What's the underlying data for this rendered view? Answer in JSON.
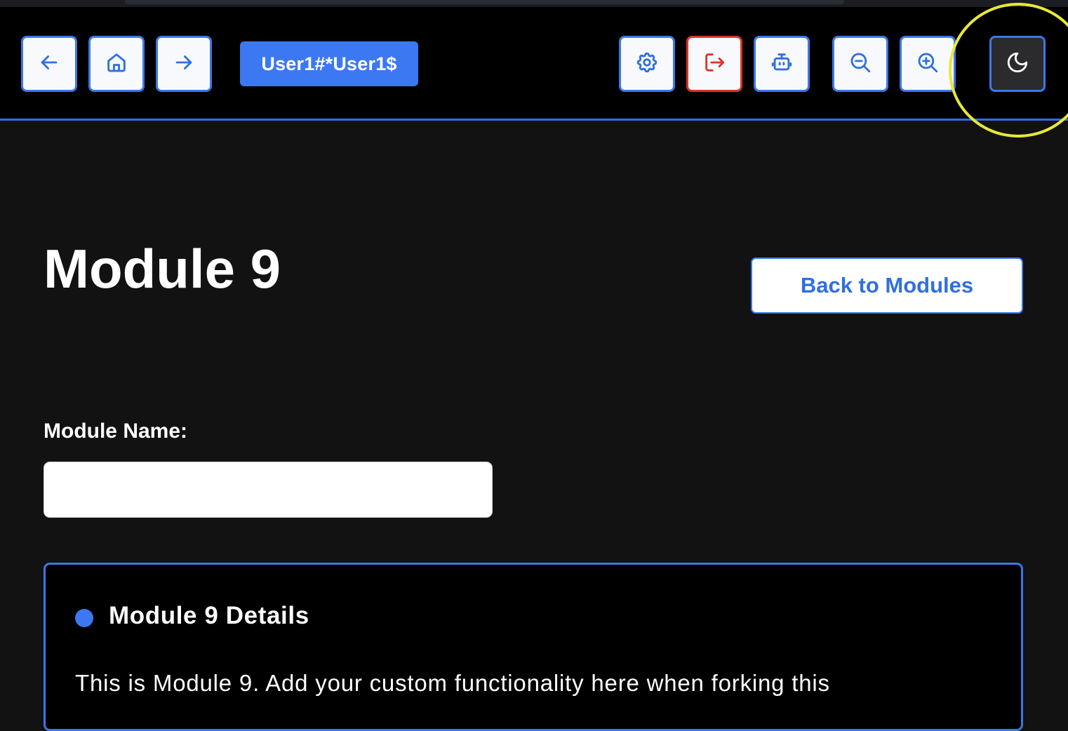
{
  "header": {
    "user_label": "User1#*User1$",
    "buttons": {
      "back": "arrow-left-icon",
      "home": "home-icon",
      "forward": "arrow-right-icon",
      "settings": "gear-icon",
      "logout": "logout-icon",
      "assistant": "robot-icon",
      "zoom_out": "zoom-out-icon",
      "zoom_in": "zoom-in-icon",
      "theme": "moon-icon"
    }
  },
  "page": {
    "title": "Module 9",
    "back_button_label": "Back to Modules",
    "name_field": {
      "label": "Module Name:",
      "value": ""
    },
    "details": {
      "title": "Module 9 Details",
      "text": "This is Module 9. Add your custom functionality here when forking this"
    }
  },
  "colors": {
    "accent": "#3b78e7",
    "danger": "#d9342b",
    "highlight": "#e8e83a",
    "background": "#121212",
    "header_background": "#000000"
  }
}
